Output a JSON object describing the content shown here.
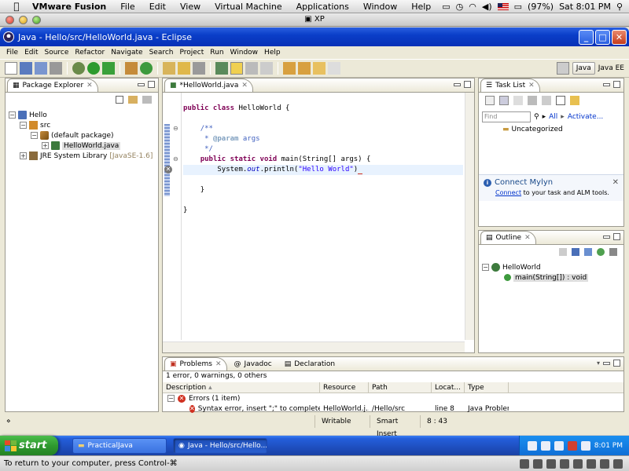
{
  "mac": {
    "app": "VMware Fusion",
    "menus": [
      "File",
      "Edit",
      "View",
      "Virtual Machine",
      "Applications",
      "Window",
      "Help"
    ],
    "battery": "(97%)",
    "clock": "Sat 8:01 PM"
  },
  "vm": {
    "window_title": "XP",
    "status": "To return to your computer, press Control-⌘"
  },
  "xp": {
    "title": "Java - Hello/src/HelloWorld.java - Eclipse"
  },
  "eclipse": {
    "menus": [
      "File",
      "Edit",
      "Source",
      "Refactor",
      "Navigate",
      "Search",
      "Project",
      "Run",
      "Window",
      "Help"
    ],
    "perspectives": [
      "Java",
      "Java EE"
    ]
  },
  "package_explorer": {
    "tab": "Package Explorer",
    "project": "Hello",
    "src": "src",
    "package": "(default package)",
    "file": "HelloWorld.java",
    "jre": "JRE System Library",
    "jre_version": "[JavaSE-1.6]"
  },
  "editor": {
    "tab": "*HelloWorld.java",
    "lines": {
      "l1_kw": "public class ",
      "l1_rest": "HelloWorld {",
      "l2": "/**",
      "l3a": " * ",
      "l3b": "@param",
      "l3c": " args",
      "l4": " */",
      "l5_kw": "public static void ",
      "l5_rest": "main(String[] args) {",
      "l6a": "System.",
      "l6b": "out",
      "l6c": ".println(",
      "l6d": "\"Hello World\"",
      "l6e": ")",
      "l7": "}",
      "l8": "}"
    }
  },
  "task_list": {
    "tab": "Task List",
    "find_placeholder": "Find",
    "all": "All",
    "activate": "Activate...",
    "category": "Uncategorized"
  },
  "mylyn": {
    "title": "Connect Mylyn",
    "connect": "Connect",
    "text": " to your task and ALM tools."
  },
  "outline": {
    "tab": "Outline",
    "class": "HelloWorld",
    "method": "main(String[]) : void"
  },
  "problems": {
    "tabs": [
      "Problems",
      "Javadoc",
      "Declaration"
    ],
    "summary": "1 error, 0 warnings, 0 others",
    "columns": [
      "Description",
      "Resource",
      "Path",
      "Locat...",
      "Type"
    ],
    "group": "Errors (1 item)",
    "row": {
      "description": "Syntax error, insert \";\" to complete Blo",
      "resource": "HelloWorld.j...",
      "path": "/Hello/src",
      "location": "line 8",
      "type": "Java Problem"
    }
  },
  "status": {
    "writable": "Writable",
    "insert": "Smart Insert",
    "position": "8 : 43"
  },
  "taskbar": {
    "start": "start",
    "items": [
      "PracticalJava",
      "Java - Hello/src/Hello..."
    ],
    "clock": "8:01 PM"
  }
}
